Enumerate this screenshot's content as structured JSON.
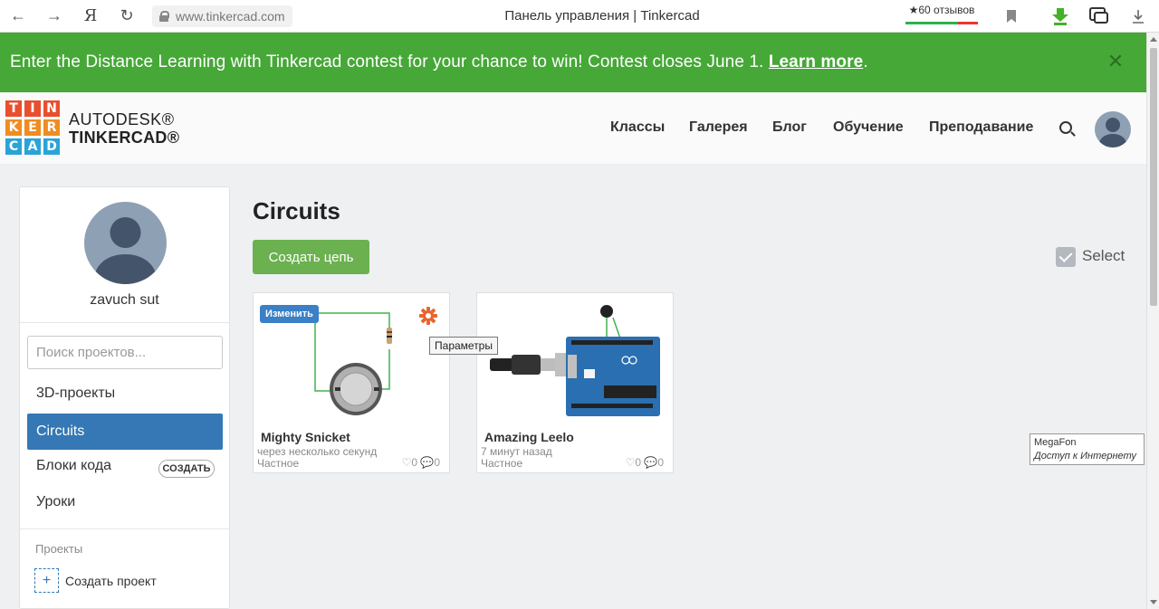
{
  "browser": {
    "url": "www.tinkercad.com",
    "tab_title": "Панель управления | Tinkercad",
    "yandex_glyph": "Я",
    "reviews": "★60 отзывов"
  },
  "banner": {
    "text": "Enter the Distance Learning with Tinkercad contest for your chance to win! Contest closes June 1.",
    "link": "Learn more",
    "link_suffix": ".",
    "close": "✕"
  },
  "header": {
    "logo_letters": [
      "T",
      "I",
      "N",
      "K",
      "E",
      "R",
      "C",
      "A",
      "D"
    ],
    "logo_colors": [
      "#e94f2e",
      "#e94f2e",
      "#e94f2e",
      "#f08c20",
      "#f08c20",
      "#f08c20",
      "#2aa3d8",
      "#2aa3d8",
      "#2aa3d8"
    ],
    "brand_line1": "AUTODESK®",
    "brand_line2": "TINKERCAD®",
    "nav": [
      "Классы",
      "Галерея",
      "Блог",
      "Обучение",
      "Преподавание"
    ]
  },
  "sidebar": {
    "username": "zavuch sut",
    "search_placeholder": "Поиск проектов...",
    "items": [
      "3D-проекты",
      "Circuits",
      "Блоки кода",
      "Уроки"
    ],
    "create_pill": "СОЗДАТЬ",
    "section_title": "Проекты",
    "plus": "+",
    "create_project": "Создать проект"
  },
  "main": {
    "title": "Circuits",
    "create_button": "Создать цепь",
    "select_label": "Select",
    "cards": [
      {
        "name": "Mighty Snicket",
        "time": "через несколько секунд",
        "privacy": "Частное",
        "stats": "♡0 💬0",
        "edit_badge": "Изменить"
      },
      {
        "name": "Amazing Leelo",
        "time": "7 минут назад",
        "privacy": "Частное",
        "stats": "♡0 💬0"
      }
    ],
    "tooltip": "Параметры"
  },
  "notice": {
    "line1": "MegaFon",
    "line2": "Доступ к Интернету"
  },
  "colors": {
    "banner": "#46a837",
    "active_item": "#3578b5",
    "create_button": "#6bb14f"
  }
}
